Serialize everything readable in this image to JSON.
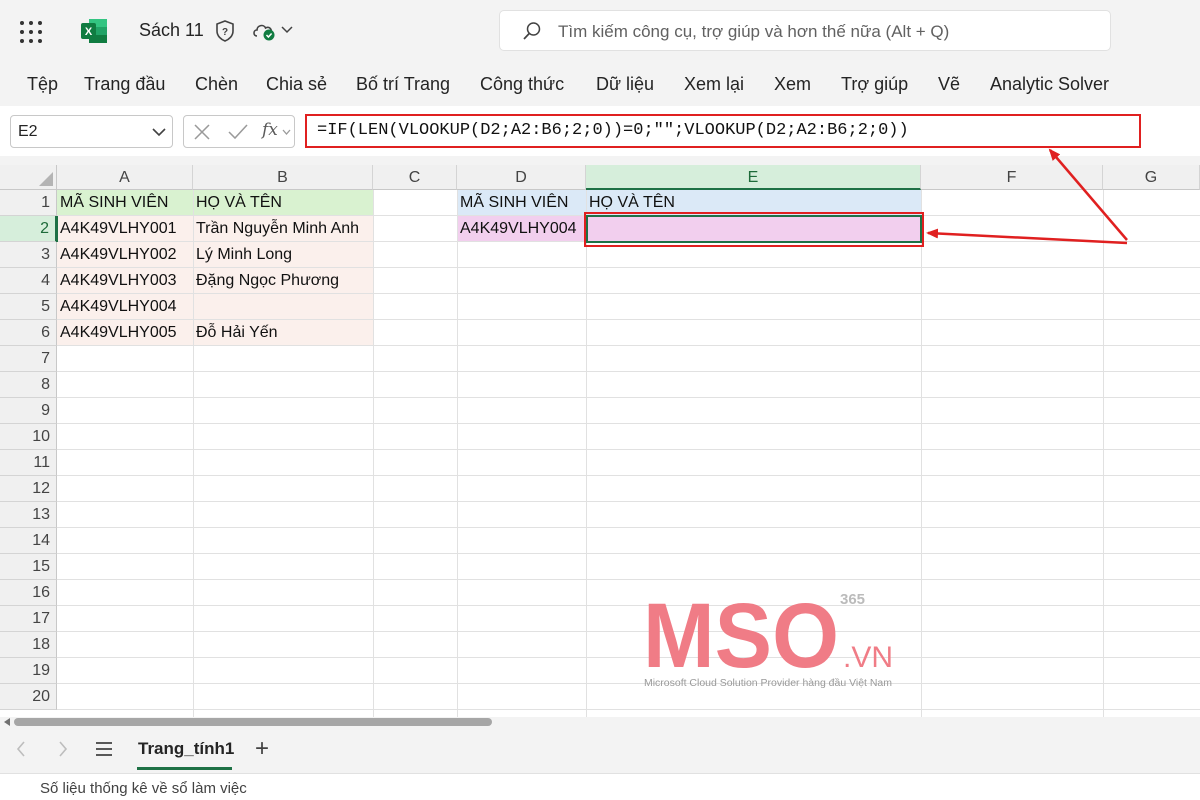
{
  "app": {
    "doc_title": "Sách 11",
    "search_placeholder": "Tìm kiếm công cụ, trợ giúp và hơn thế nữa (Alt + Q)"
  },
  "menu": [
    "Tệp",
    "Trang đầu",
    "Chèn",
    "Chia sẻ",
    "Bố trí Trang",
    "Công thức",
    "Dữ liệu",
    "Xem lại",
    "Xem",
    "Trợ giúp",
    "Vẽ",
    "Analytic Solver"
  ],
  "formula_bar": {
    "name_box": "E2",
    "fx_label": "fx",
    "formula": "=IF(LEN(VLOOKUP(D2;A2:B6;2;0))=0;\"\";VLOOKUP(D2;A2:B6;2;0))"
  },
  "columns": [
    "A",
    "B",
    "C",
    "D",
    "E",
    "F",
    "G"
  ],
  "rows": [
    "1",
    "2",
    "3",
    "4",
    "5",
    "6",
    "7",
    "8",
    "9",
    "10",
    "11",
    "12",
    "13",
    "14",
    "15",
    "16",
    "17",
    "18",
    "19",
    "20"
  ],
  "cells": {
    "A1": "MÃ SINH VIÊN",
    "B1": "HỌ VÀ TÊN",
    "A2": "A4K49VLHY001",
    "B2": "Trần Nguyễn Minh Anh",
    "A3": "A4K49VLHY002",
    "B3": "Lý Minh Long",
    "A4": "A4K49VLHY003",
    "B4": "Đặng Ngọc Phương",
    "A5": "A4K49VLHY004",
    "B5": "",
    "A6": "A4K49VLHY005",
    "B6": "Đỗ Hải Yến",
    "D1": "MÃ SINH VIÊN",
    "E1": "HỌ VÀ TÊN",
    "D2": "A4K49VLHY004",
    "E2": ""
  },
  "watermark": {
    "logo": "MSO",
    "superscript": "365",
    "suffix": ".VN",
    "tagline": "Microsoft Cloud Solution Provider hàng đầu Việt Nam"
  },
  "sheet_tab": "Trang_tính1",
  "status_text": "Số liệu thống kê về sổ làm việc",
  "colors": {
    "accent_green": "#1e7145",
    "highlight_red": "#e02020",
    "header_green_fill": "#d9f2d0",
    "data_pink_fill": "#fbf0ec",
    "lookup_blue_fill": "#dbe9f7",
    "result_pink_fill": "#f2cfee"
  }
}
